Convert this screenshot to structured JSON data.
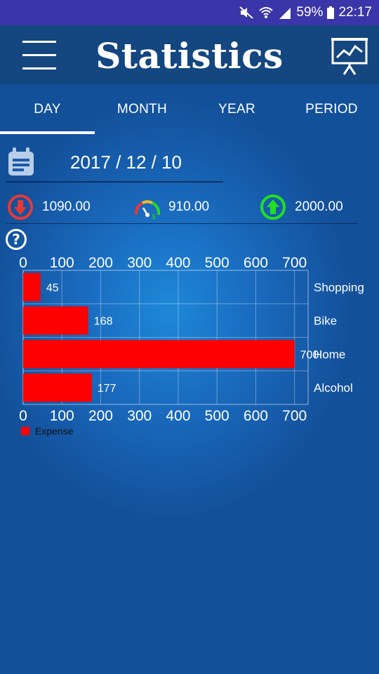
{
  "status_bar": {
    "battery": "59%",
    "time": "22:17"
  },
  "header": {
    "title": "Statistics"
  },
  "tabs": [
    {
      "label": "DAY",
      "selected": true
    },
    {
      "label": "MONTH",
      "selected": false
    },
    {
      "label": "YEAR",
      "selected": false
    },
    {
      "label": "PERIOD",
      "selected": false
    }
  ],
  "date": "2017 / 12 / 10",
  "summary": {
    "expense": "1090.00",
    "balance": "910.00",
    "income": "2000.00"
  },
  "colors": {
    "expense": "#ff0000",
    "income": "#22dd22",
    "appbar": "#14467f",
    "statusbar": "#3a35a8"
  },
  "chart_data": {
    "type": "bar",
    "orientation": "horizontal",
    "categories": [
      "Shopping",
      "Bike",
      "Home",
      "Alcohol"
    ],
    "series": [
      {
        "name": "Expense",
        "values": [
          45,
          168,
          700,
          177
        ]
      }
    ],
    "xlim": [
      0,
      735
    ],
    "xticks": [
      0,
      100,
      200,
      300,
      400,
      500,
      600,
      700
    ],
    "grid": true,
    "legend": "bottom-left"
  }
}
